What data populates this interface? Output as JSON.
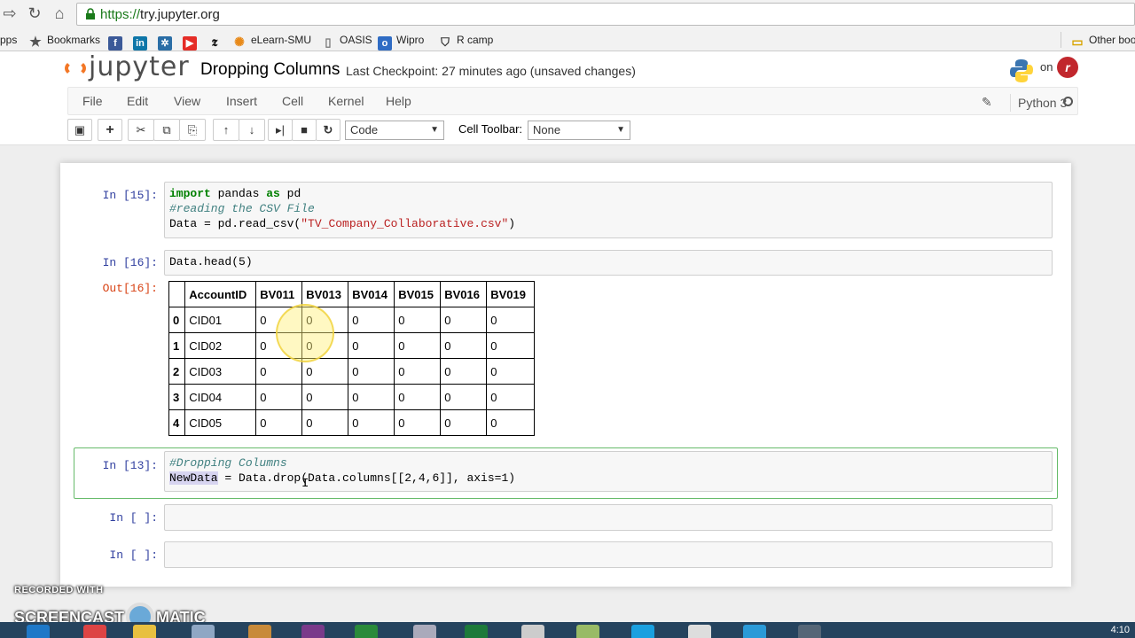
{
  "browser": {
    "url_scheme": "https://",
    "url_rest": "try.jupyter.org",
    "bookmarks": [
      "pps",
      "Bookmarks",
      "eLearn-SMU",
      "OASIS",
      "Wipro",
      "R camp",
      "Other boo"
    ]
  },
  "header": {
    "logo_text": "jupyter",
    "notebook_title": "Dropping Columns",
    "checkpoint": "Last Checkpoint: 27 minutes ago (unsaved changes)",
    "on_text": "on"
  },
  "menu": [
    "File",
    "Edit",
    "View",
    "Insert",
    "Cell",
    "Kernel",
    "Help"
  ],
  "kernel_name": "Python 3",
  "toolbar": {
    "cell_type": "Code",
    "cell_toolbar_label": "Cell Toolbar:",
    "cell_toolbar_value": "None"
  },
  "cells": {
    "c1_prompt": "In [15]:",
    "c1_l1_kw1": "import",
    "c1_l1_mid": " pandas ",
    "c1_l1_kw2": "as",
    "c1_l1_end": " pd",
    "c1_l2": "#reading the CSV File",
    "c1_l3_a": "Data = pd.read_csv(",
    "c1_l3_str": "\"TV_Company_Collaborative.csv\"",
    "c1_l3_b": ")",
    "c2_prompt": "In [16]:",
    "c2_code": "Data.head(5)",
    "out_prompt": "Out[16]:",
    "c3_prompt": "In [13]:",
    "c3_l1": "#Dropping Columns",
    "c3_l2_hl": "NewData",
    "c3_l2_rest": " = Data.drop(Data.columns[[2,4,6]], axis=1)",
    "c4_prompt": "In [ ]:",
    "c5_prompt": "In [ ]:"
  },
  "dataframe": {
    "columns": [
      "",
      "AccountID",
      "BV011",
      "BV013",
      "BV014",
      "BV015",
      "BV016",
      "BV019"
    ],
    "rows": [
      [
        "0",
        "CID01",
        "0",
        "0",
        "0",
        "0",
        "0",
        "0"
      ],
      [
        "1",
        "CID02",
        "0",
        "0",
        "0",
        "0",
        "0",
        "0"
      ],
      [
        "2",
        "CID03",
        "0",
        "0",
        "0",
        "0",
        "0",
        "0"
      ],
      [
        "3",
        "CID04",
        "0",
        "0",
        "0",
        "0",
        "0",
        "0"
      ],
      [
        "4",
        "CID05",
        "0",
        "0",
        "0",
        "0",
        "0",
        "0"
      ]
    ]
  },
  "watermark": {
    "line1": "RECORDED WITH",
    "line2a": "SCREENCAST",
    "line2b": "MATIC"
  },
  "clock": "4:10"
}
